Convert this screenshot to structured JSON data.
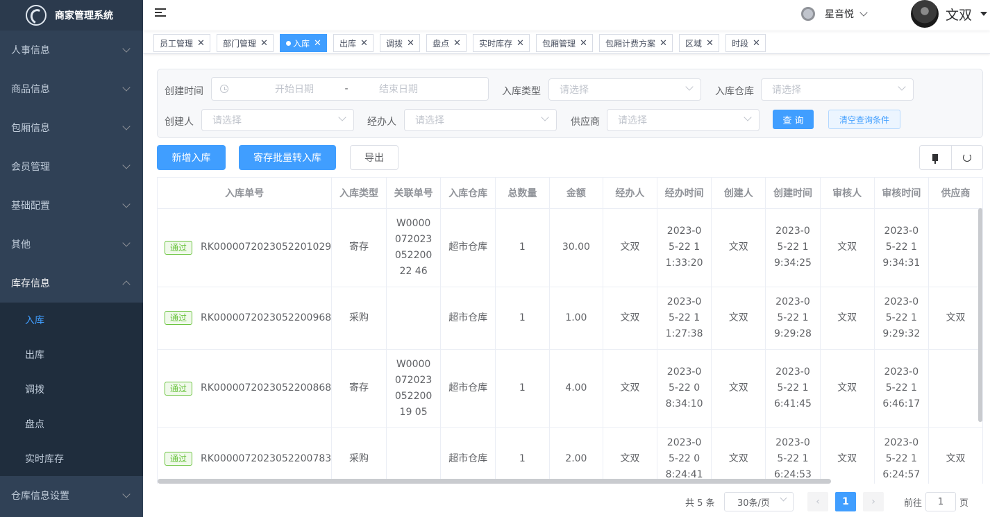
{
  "app": {
    "title": "商家管理系统"
  },
  "sidebar": {
    "items": [
      {
        "label": "人事信息"
      },
      {
        "label": "商品信息"
      },
      {
        "label": "包厢信息"
      },
      {
        "label": "会员管理"
      },
      {
        "label": "基础配置"
      },
      {
        "label": "其他"
      },
      {
        "label": "库存信息"
      }
    ],
    "sub_items": [
      {
        "label": "入库"
      },
      {
        "label": "出库"
      },
      {
        "label": "调拨"
      },
      {
        "label": "盘点"
      },
      {
        "label": "实时库存"
      }
    ],
    "last_item": {
      "label": "仓库信息设置"
    }
  },
  "header": {
    "store_name": "星音悦",
    "user_name": "文双"
  },
  "tags": [
    {
      "label": "员工管理"
    },
    {
      "label": "部门管理"
    },
    {
      "label": "入库"
    },
    {
      "label": "出库"
    },
    {
      "label": "调拨"
    },
    {
      "label": "盘点"
    },
    {
      "label": "实时库存"
    },
    {
      "label": "包厢管理"
    },
    {
      "label": "包厢计费方案"
    },
    {
      "label": "区域"
    },
    {
      "label": "时段"
    }
  ],
  "search": {
    "created_time_label": "创建时间",
    "start_placeholder": "开始日期",
    "range_separator": "-",
    "end_placeholder": "结束日期",
    "type_label": "入库类型",
    "warehouse_label": "入库仓库",
    "creator_label": "创建人",
    "handler_label": "经办人",
    "supplier_label": "供应商",
    "select_placeholder": "请选择",
    "query_button": "查 询",
    "clear_button": "清空查询条件"
  },
  "actions": {
    "add": "新增入库",
    "batch": "寄存批量转入库",
    "export": "导出"
  },
  "table": {
    "headers": [
      "入库单号",
      "入库类型",
      "关联单号",
      "入库仓库",
      "总数量",
      "金额",
      "经办人",
      "经办时间",
      "创建人",
      "创建时间",
      "审核人",
      "审核时间",
      "供应商"
    ],
    "rows": [
      {
        "status": "通过",
        "order_no": "RK0000072023052201029",
        "type": "寄存",
        "related": "W000007202305220022 46",
        "warehouse": "超市仓库",
        "qty": "1",
        "amount": "30.00",
        "handler": "文双",
        "handle_time": "2023-05-22 11:33:20",
        "creator": "文双",
        "create_time": "2023-05-22 19:34:25",
        "auditor": "文双",
        "audit_time": "2023-05-22 19:34:31",
        "supplier": ""
      },
      {
        "status": "通过",
        "order_no": "RK0000072023052200968",
        "type": "采购",
        "related": "",
        "warehouse": "超市仓库",
        "qty": "1",
        "amount": "1.00",
        "handler": "文双",
        "handle_time": "2023-05-22 11:27:38",
        "creator": "文双",
        "create_time": "2023-05-22 19:29:28",
        "auditor": "文双",
        "audit_time": "2023-05-22 19:29:32",
        "supplier": "文双"
      },
      {
        "status": "通过",
        "order_no": "RK0000072023052200868",
        "type": "寄存",
        "related": "W000007202305220019 05",
        "warehouse": "超市仓库",
        "qty": "1",
        "amount": "4.00",
        "handler": "文双",
        "handle_time": "2023-05-22 08:34:10",
        "creator": "文双",
        "create_time": "2023-05-22 16:41:45",
        "auditor": "文双",
        "audit_time": "2023-05-22 16:46:17",
        "supplier": ""
      },
      {
        "status": "通过",
        "order_no": "RK0000072023052200783",
        "type": "采购",
        "related": "",
        "warehouse": "超市仓库",
        "qty": "1",
        "amount": "2.00",
        "handler": "文双",
        "handle_time": "2023-05-22 08:24:41",
        "creator": "文双",
        "create_time": "2023-05-22 16:24:53",
        "auditor": "文双",
        "audit_time": "2023-05-22 16:24:57",
        "supplier": "文双"
      }
    ]
  },
  "pagination": {
    "total_text": "共 5 条",
    "page_size": "30条/页",
    "current_page": "1",
    "goto_label": "前往",
    "goto_value": "1",
    "page_unit": "页"
  },
  "colors": {
    "accent": "#409eff",
    "sidebar_bg": "#304156",
    "success": "#67c23a"
  }
}
